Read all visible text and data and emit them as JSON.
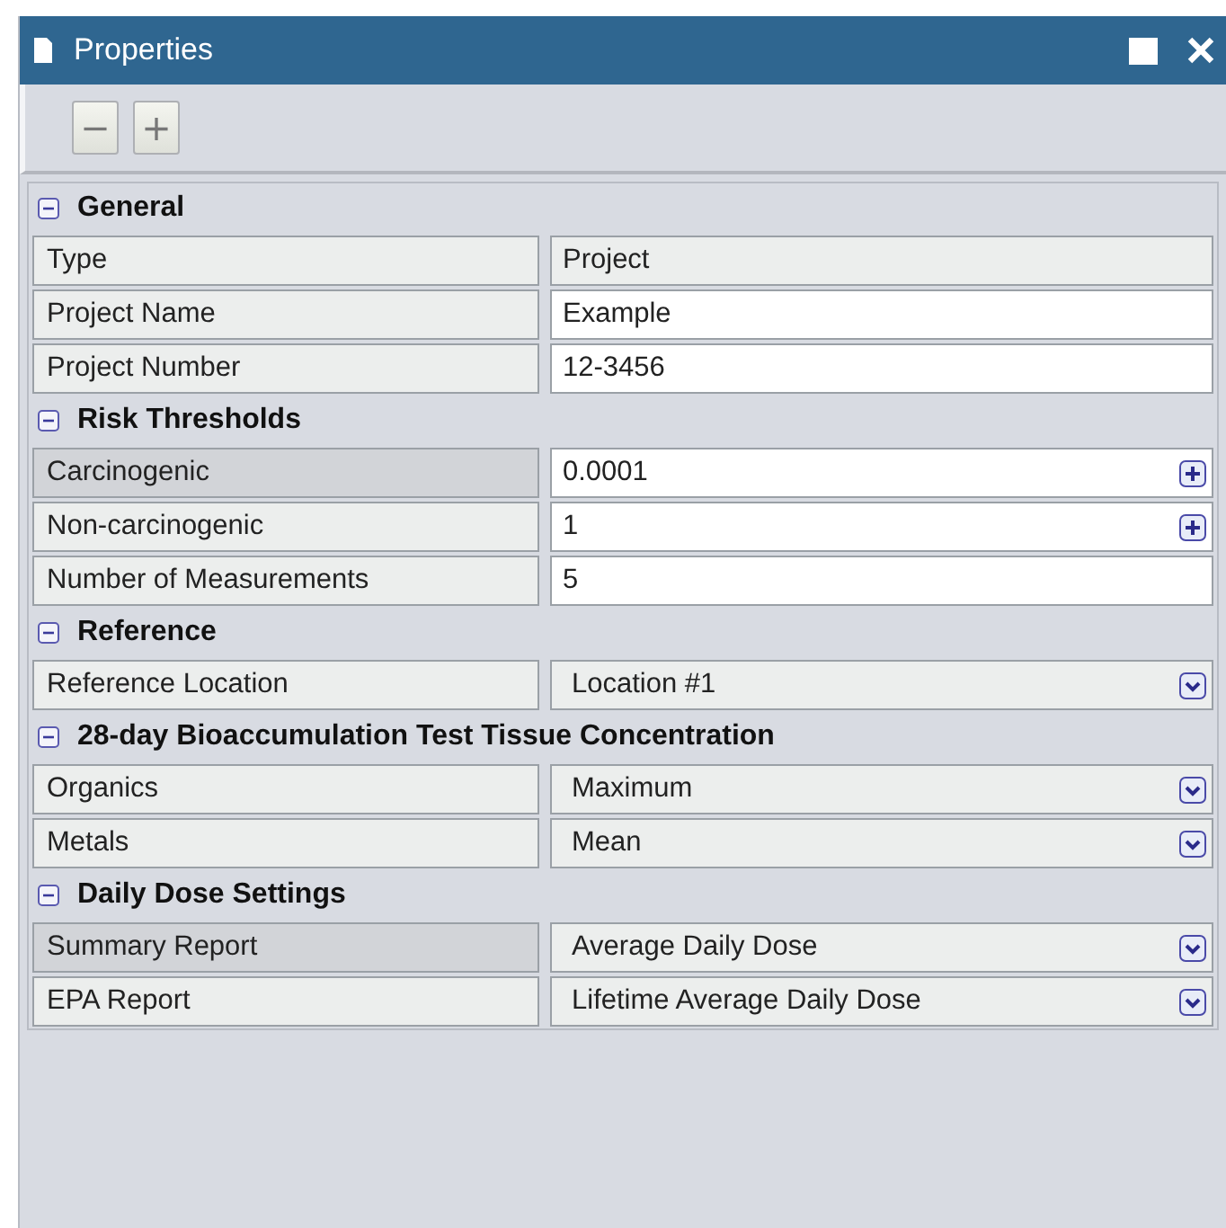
{
  "window": {
    "title": "Properties"
  },
  "toolbar": {
    "buttons": [
      {
        "label": "−",
        "disabled": false
      },
      {
        "label": "+",
        "disabled": false
      }
    ]
  },
  "sections": [
    {
      "title": "General",
      "expanded": true,
      "rows": [
        {
          "label": "Type",
          "value": "Project",
          "kind": "readonly",
          "selected": false
        },
        {
          "label": "Project Name",
          "value": "Example",
          "kind": "text",
          "selected": false
        },
        {
          "label": "Project Number",
          "value": "12-3456",
          "kind": "text",
          "selected": false
        }
      ]
    },
    {
      "title": "Risk Thresholds",
      "expanded": true,
      "rows": [
        {
          "label": "Carcinogenic",
          "value": "0.0001",
          "kind": "spinner",
          "selected": true
        },
        {
          "label": "Non-carcinogenic",
          "value": "1",
          "kind": "spinner",
          "selected": false
        },
        {
          "label": "Number of Measurements",
          "value": "5",
          "kind": "text",
          "selected": false
        }
      ]
    },
    {
      "title": "Reference",
      "expanded": true,
      "rows": [
        {
          "label": "Reference Location",
          "value": "Location #1",
          "kind": "dropdown",
          "selected": false
        }
      ]
    },
    {
      "title": "28-day Bioaccumulation Test Tissue Concentration",
      "expanded": true,
      "rows": [
        {
          "label": "Organics",
          "value": "Maximum",
          "kind": "dropdown",
          "selected": false
        },
        {
          "label": "Metals",
          "value": "Mean",
          "kind": "dropdown",
          "selected": false
        }
      ]
    },
    {
      "title": "Daily Dose Settings",
      "expanded": true,
      "rows": [
        {
          "label": "Summary Report",
          "value": "Average Daily Dose",
          "kind": "dropdown",
          "selected": true
        },
        {
          "label": "EPA Report",
          "value": "Lifetime Average Daily Dose",
          "kind": "dropdown",
          "selected": false
        }
      ]
    }
  ]
}
